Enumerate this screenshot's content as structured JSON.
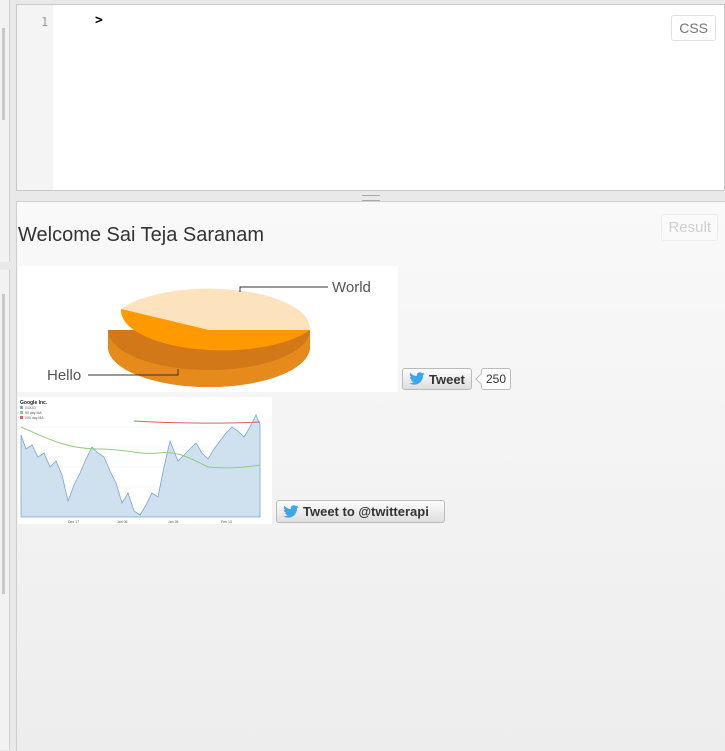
{
  "editor": {
    "line_number": "1",
    "code": ">",
    "label": "CSS"
  },
  "result": {
    "label": "Result",
    "welcome": "Welcome Sai Teja Saranam",
    "pie_chart": {
      "labels": [
        "World",
        "Hello"
      ],
      "colors": {
        "world": "#fde3bd",
        "hello": "#ff9900",
        "hello_side": "#d87a10"
      }
    },
    "stock_chart": {
      "title": "Google Inc.",
      "legend": [
        "GOOG",
        "50 day MA",
        "200 day MA"
      ],
      "x_ticks": [
        "Dec 17",
        "Jan 06",
        "Jan 26",
        "Feb 13"
      ],
      "colors": {
        "price": "#7aa5cf",
        "fill": "#cfe0ef",
        "ma50": "#8ccf7a",
        "ma200": "#e06060"
      }
    },
    "tweet_button": {
      "label": "Tweet",
      "count": "250"
    },
    "tweet_to_button": {
      "label": "Tweet to @twitterapi"
    },
    "accent_color": "#3ba7e8"
  }
}
